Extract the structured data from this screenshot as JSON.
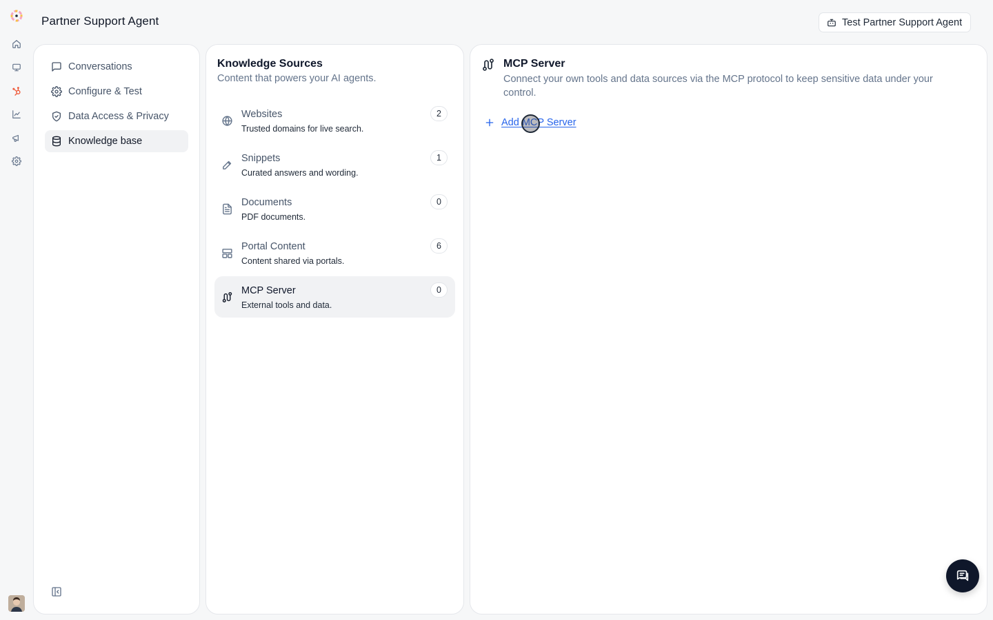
{
  "header": {
    "title": "Partner Support Agent",
    "test_button_label": "Test Partner Support Agent"
  },
  "rail": {
    "items": [
      {
        "name": "home-icon"
      },
      {
        "name": "monitor-icon"
      },
      {
        "name": "hubspot-icon",
        "active": true
      },
      {
        "name": "chart-line-icon"
      },
      {
        "name": "megaphone-icon"
      },
      {
        "name": "gear-icon"
      }
    ],
    "accent_color": "#ef5b3b"
  },
  "sidebar": {
    "items": [
      {
        "label": "Conversations",
        "icon": "message-square-icon"
      },
      {
        "label": "Configure & Test",
        "icon": "gear-icon"
      },
      {
        "label": "Data Access & Privacy",
        "icon": "shield-check-icon"
      },
      {
        "label": "Knowledge base",
        "icon": "database-icon",
        "active": true
      }
    ]
  },
  "knowledge": {
    "title": "Knowledge Sources",
    "subtitle": "Content that powers your AI agents.",
    "sources": [
      {
        "name": "Websites",
        "desc": "Trusted domains for live search.",
        "count": "2",
        "icon": "globe-icon"
      },
      {
        "name": "Snippets",
        "desc": "Curated answers and wording.",
        "count": "1",
        "icon": "pencil-icon"
      },
      {
        "name": "Documents",
        "desc": "PDF documents.",
        "count": "0",
        "icon": "file-text-icon"
      },
      {
        "name": "Portal Content",
        "desc": "Content shared via portals.",
        "count": "6",
        "icon": "layout-icon"
      },
      {
        "name": "MCP Server",
        "desc": "External tools and data.",
        "count": "0",
        "icon": "route-icon",
        "active": true
      }
    ]
  },
  "detail": {
    "title": "MCP Server",
    "description": "Connect your own tools and data sources via the MCP protocol to keep sensitive data under your control.",
    "add_label": "Add MCP Server"
  },
  "colors": {
    "link": "#2563eb",
    "fab": "#0f172a"
  }
}
